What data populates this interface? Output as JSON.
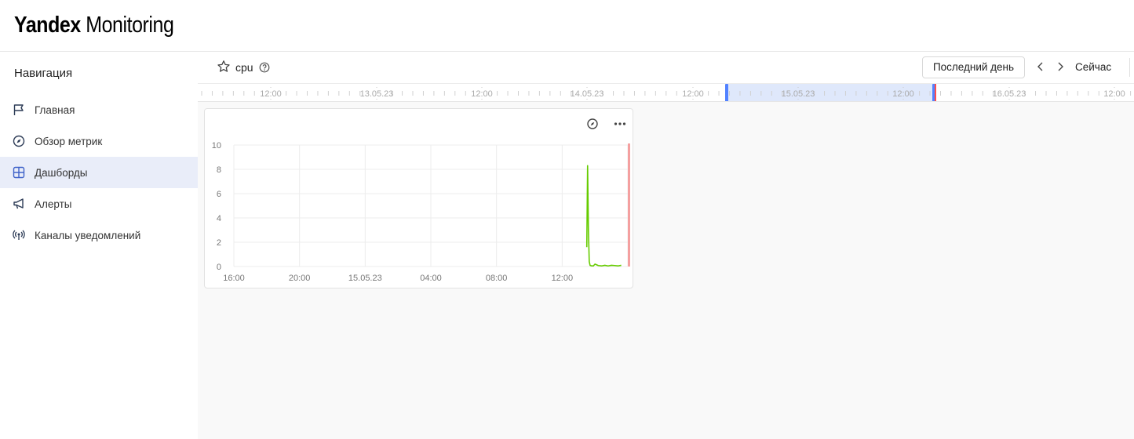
{
  "app": {
    "logo_bold": "Yandex",
    "logo_light": " Monitoring"
  },
  "sidebar": {
    "title": "Навигация",
    "items": [
      {
        "label": "Главная",
        "icon": "flag-icon",
        "active": false
      },
      {
        "label": "Обзор метрик",
        "icon": "compass-icon",
        "active": false
      },
      {
        "label": "Дашборды",
        "icon": "dashboard-icon",
        "active": true
      },
      {
        "label": "Алерты",
        "icon": "megaphone-icon",
        "active": false
      },
      {
        "label": "Каналы уведомлений",
        "icon": "broadcast-icon",
        "active": false
      }
    ]
  },
  "dashboard": {
    "title": "cpu",
    "range_label": "Последний день",
    "now_label": "Сейчас"
  },
  "timeline": {
    "labels": [
      "12:00",
      "13.05.23",
      "12:00",
      "14.05.23",
      "12:00",
      "15.05.23",
      "12:00",
      "16.05.23",
      "12:00"
    ],
    "selection_color": "#dfe8fb",
    "handle_color": "#5282ff",
    "now_color": "#ff4d4d"
  },
  "chart_data": {
    "type": "line",
    "xlabel": "",
    "ylabel": "",
    "x_ticks": [
      "16:00",
      "20:00",
      "15.05.23",
      "04:00",
      "08:00",
      "12:00"
    ],
    "y_ticks": [
      "0",
      "2",
      "4",
      "6",
      "8",
      "10"
    ],
    "ylim": [
      0,
      10
    ],
    "x_range_hours": [
      0,
      24
    ],
    "grid": true,
    "series": [
      {
        "color": "#66cc00",
        "x_hours": [
          21.5,
          21.55,
          21.6,
          21.65,
          21.7,
          21.8,
          21.9,
          22.0,
          22.2,
          22.4,
          22.6,
          22.8,
          23.0,
          23.2,
          23.4,
          23.6
        ],
        "values": [
          1.6,
          8.3,
          3.0,
          0.4,
          0.1,
          0.05,
          0.05,
          0.2,
          0.08,
          0.05,
          0.1,
          0.05,
          0.1,
          0.08,
          0.05,
          0.1
        ]
      }
    ],
    "now_marker_color": "#f4a0a0"
  }
}
